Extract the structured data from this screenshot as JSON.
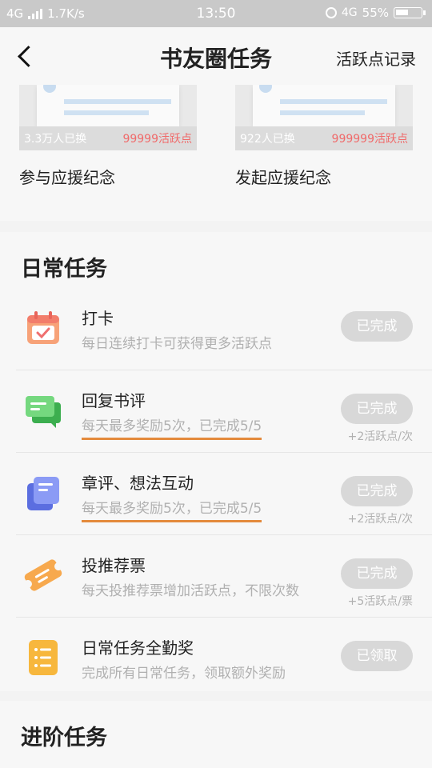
{
  "status_bar": {
    "network": "4G",
    "speed": "1.7K/s",
    "time": "13:50",
    "net_type": "4G",
    "battery": "55%"
  },
  "header": {
    "title": "书友圈任务",
    "record_link": "活跃点记录"
  },
  "redeem": [
    {
      "count": "3.3万人已换",
      "points": "99999活跃点",
      "label": "参与应援纪念"
    },
    {
      "count": "922人已换",
      "points": "999999活跃点",
      "label": "发起应援纪念"
    }
  ],
  "daily": {
    "title": "日常任务",
    "tasks": [
      {
        "name": "打卡",
        "desc": "每日连续打卡可获得更多活跃点",
        "status": "已完成",
        "reward": "",
        "icon": "calendar-icon",
        "color": "#f27d6b"
      },
      {
        "name": "回复书评",
        "desc": "每天最多奖励5次，已完成5/5",
        "status": "已完成",
        "reward": "+2活跃点/次",
        "icon": "comment-icon",
        "color": "#5cc86a"
      },
      {
        "name": "章评、想法互动",
        "desc": "每天最多奖励5次，已完成5/5",
        "status": "已完成",
        "reward": "+2活跃点/次",
        "icon": "notes-icon",
        "color": "#6b7df2"
      },
      {
        "name": "投推荐票",
        "desc": "每天投推荐票增加活跃点，不限次数",
        "status": "已完成",
        "reward": "+5活跃点/票",
        "icon": "ticket-icon",
        "color": "#f5a04e"
      },
      {
        "name": "日常任务全勤奖",
        "desc": "完成所有日常任务，领取额外奖励",
        "status": "已领取",
        "reward": "",
        "icon": "list-icon",
        "color": "#f7b73d"
      }
    ]
  },
  "advanced": {
    "title": "进阶任务"
  }
}
